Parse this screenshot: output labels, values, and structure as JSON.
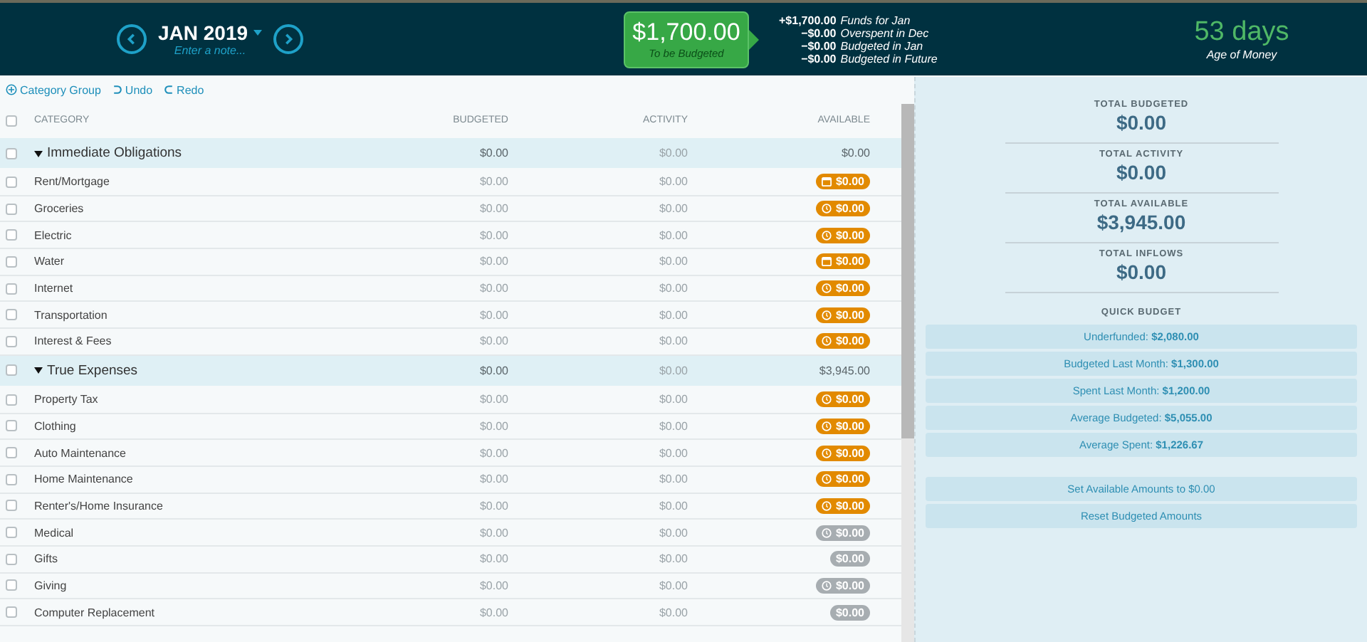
{
  "header": {
    "month": "JAN 2019",
    "note_placeholder": "Enter a note...",
    "to_be_budgeted": {
      "amount": "$1,700.00",
      "label": "To be Budgeted"
    },
    "breakdown": [
      {
        "amount": "+$1,700.00",
        "label": "Funds for Jan"
      },
      {
        "amount": "−$0.00",
        "label": "Overspent in Dec"
      },
      {
        "amount": "−$0.00",
        "label": "Budgeted in Jan"
      },
      {
        "amount": "−$0.00",
        "label": "Budgeted in Future"
      }
    ],
    "age_of_money": {
      "value": "53 days",
      "label": "Age of Money"
    }
  },
  "toolbar": [
    {
      "kind": "add",
      "label": "Category Group"
    },
    {
      "kind": "undo",
      "label": "Undo"
    },
    {
      "kind": "redo",
      "label": "Redo"
    }
  ],
  "table": {
    "columns": [
      "CATEGORY",
      "BUDGETED",
      "ACTIVITY",
      "AVAILABLE"
    ],
    "header_checked": false,
    "groups": [
      {
        "name": "Immediate Obligations",
        "expanded": true,
        "checked": false,
        "budgeted": "$0.00",
        "activity": "$0.00",
        "available": "$0.00",
        "categories": [
          {
            "name": "Rent/Mortgage",
            "checked": false,
            "budgeted": "$0.00",
            "activity": "$0.00",
            "available": "$0.00",
            "kind": "calendar",
            "muted": false
          },
          {
            "name": "Groceries",
            "checked": false,
            "budgeted": "$0.00",
            "activity": "$0.00",
            "available": "$0.00",
            "kind": "clock",
            "muted": false
          },
          {
            "name": "Electric",
            "checked": false,
            "budgeted": "$0.00",
            "activity": "$0.00",
            "available": "$0.00",
            "kind": "clock",
            "muted": false
          },
          {
            "name": "Water",
            "checked": false,
            "budgeted": "$0.00",
            "activity": "$0.00",
            "available": "$0.00",
            "kind": "calendar",
            "muted": false
          },
          {
            "name": "Internet",
            "checked": false,
            "budgeted": "$0.00",
            "activity": "$0.00",
            "available": "$0.00",
            "kind": "clock",
            "muted": false
          },
          {
            "name": "Transportation",
            "checked": false,
            "budgeted": "$0.00",
            "activity": "$0.00",
            "available": "$0.00",
            "kind": "clock",
            "muted": false
          },
          {
            "name": "Interest & Fees",
            "checked": false,
            "budgeted": "$0.00",
            "activity": "$0.00",
            "available": "$0.00",
            "kind": "clock",
            "muted": false
          }
        ]
      },
      {
        "name": "True Expenses",
        "expanded": true,
        "checked": false,
        "budgeted": "$0.00",
        "activity": "$0.00",
        "available": "$3,945.00",
        "categories": [
          {
            "name": "Property Tax",
            "checked": false,
            "budgeted": "$0.00",
            "activity": "$0.00",
            "available": "$0.00",
            "kind": "clock",
            "muted": false
          },
          {
            "name": "Clothing",
            "checked": false,
            "budgeted": "$0.00",
            "activity": "$0.00",
            "available": "$0.00",
            "kind": "clock",
            "muted": false
          },
          {
            "name": "Auto Maintenance",
            "checked": false,
            "budgeted": "$0.00",
            "activity": "$0.00",
            "available": "$0.00",
            "kind": "clock",
            "muted": false
          },
          {
            "name": "Home Maintenance",
            "checked": false,
            "budgeted": "$0.00",
            "activity": "$0.00",
            "available": "$0.00",
            "kind": "clock",
            "muted": false
          },
          {
            "name": "Renter's/Home Insurance",
            "checked": false,
            "budgeted": "$0.00",
            "activity": "$0.00",
            "available": "$0.00",
            "kind": "clock",
            "muted": false
          },
          {
            "name": "Medical",
            "checked": false,
            "budgeted": "$0.00",
            "activity": "$0.00",
            "available": "$0.00",
            "kind": "clock",
            "muted": true
          },
          {
            "name": "Gifts",
            "checked": false,
            "budgeted": "$0.00",
            "activity": "$0.00",
            "available": "$0.00",
            "kind": "plain",
            "muted": true
          },
          {
            "name": "Giving",
            "checked": false,
            "budgeted": "$0.00",
            "activity": "$0.00",
            "available": "$0.00",
            "kind": "clock",
            "muted": true
          },
          {
            "name": "Computer Replacement",
            "checked": false,
            "budgeted": "$0.00",
            "activity": "$0.00",
            "available": "$0.00",
            "kind": "plain",
            "muted": true
          }
        ]
      }
    ]
  },
  "inspector": {
    "totals": [
      {
        "label": "TOTAL BUDGETED",
        "value": "$0.00"
      },
      {
        "label": "TOTAL ACTIVITY",
        "value": "$0.00"
      },
      {
        "label": "TOTAL AVAILABLE",
        "value": "$3,945.00"
      },
      {
        "label": "TOTAL INFLOWS",
        "value": "$0.00"
      }
    ],
    "quick_budget_title": "QUICK BUDGET",
    "quick_budget": [
      "Underfunded: **$2,080.00**",
      "Budgeted Last Month: **$1,300.00**",
      "Spent Last Month: **$1,200.00**",
      "Average Budgeted: **$5,055.00**",
      "Average Spent: **$1,226.67**"
    ],
    "actions": [
      "Set Available Amounts to $0.00",
      "Reset Budgeted Amounts"
    ]
  }
}
